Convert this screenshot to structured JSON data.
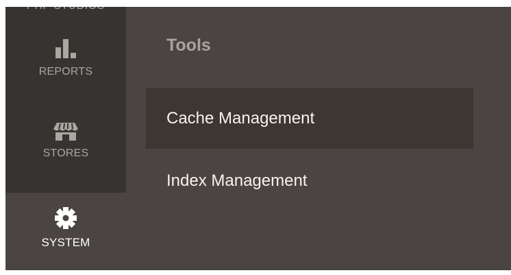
{
  "sidebar": {
    "top_cut_label": "PHP STUDIOS",
    "items": [
      {
        "label": "REPORTS",
        "icon": "bar-chart-icon"
      },
      {
        "label": "STORES",
        "icon": "storefront-icon"
      },
      {
        "label": "SYSTEM",
        "icon": "gear-icon"
      }
    ]
  },
  "submenu": {
    "title": "Tools",
    "items": [
      {
        "label": "Cache Management"
      },
      {
        "label": "Index Management"
      }
    ]
  },
  "colors": {
    "frame_bg": "#4a4542",
    "sidebar_bg": "#373330",
    "hover_bg": "#3e3632",
    "submenu_title": "#a8a39d",
    "submenu_text": "#f7f3eb"
  }
}
